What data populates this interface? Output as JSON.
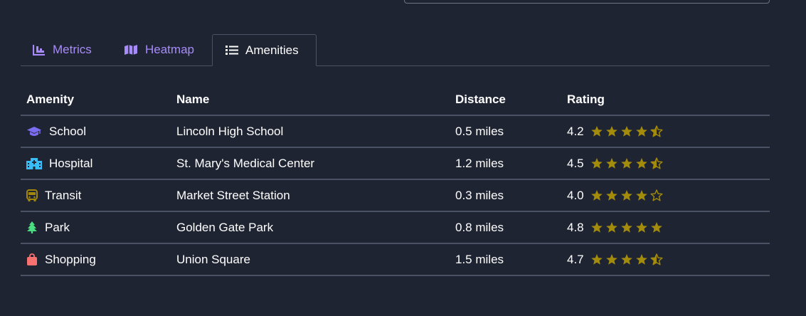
{
  "tabs": [
    {
      "label": "Metrics",
      "icon": "bar-chart-icon",
      "active": false
    },
    {
      "label": "Heatmap",
      "icon": "map-icon",
      "active": false
    },
    {
      "label": "Amenities",
      "icon": "list-icon",
      "active": true
    }
  ],
  "table": {
    "headers": {
      "amenity": "Amenity",
      "name": "Name",
      "distance": "Distance",
      "rating": "Rating"
    },
    "rows": [
      {
        "amenity": "School",
        "icon": "graduation-cap-icon",
        "icon_color": "#7c6cf0",
        "name": "Lincoln High School",
        "distance": "0.5 miles",
        "rating": "4.2",
        "stars": 4.5
      },
      {
        "amenity": "Hospital",
        "icon": "hospital-icon",
        "icon_color": "#38bdf8",
        "name": "St. Mary's Medical Center",
        "distance": "1.2 miles",
        "rating": "4.5",
        "stars": 4.5
      },
      {
        "amenity": "Transit",
        "icon": "bus-icon",
        "icon_color": "#a3870a",
        "name": "Market Street Station",
        "distance": "0.3 miles",
        "rating": "4.0",
        "stars": 4
      },
      {
        "amenity": "Park",
        "icon": "tree-icon",
        "icon_color": "#4ade80",
        "name": "Golden Gate Park",
        "distance": "0.8 miles",
        "rating": "4.8",
        "stars": 5
      },
      {
        "amenity": "Shopping",
        "icon": "shopping-bag-icon",
        "icon_color": "#f87171",
        "name": "Union Square",
        "distance": "1.5 miles",
        "rating": "4.7",
        "stars": 4.5
      }
    ]
  },
  "colors": {
    "accent": "#a78bfa",
    "star": "#a38b0b",
    "background": "#1f2433",
    "divider": "#4b5263"
  }
}
